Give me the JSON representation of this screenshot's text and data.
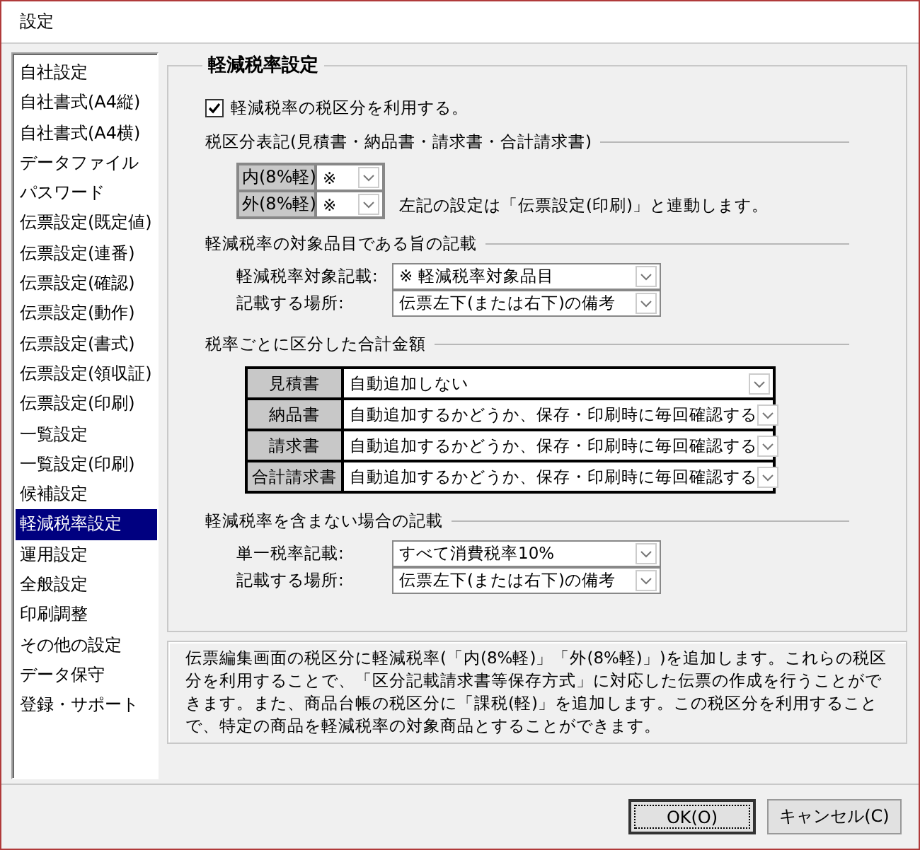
{
  "window": {
    "title": "設定"
  },
  "sidebar": {
    "items": [
      {
        "label": "自社設定",
        "selected": false
      },
      {
        "label": "自社書式(A4縦)",
        "selected": false
      },
      {
        "label": "自社書式(A4横)",
        "selected": false
      },
      {
        "label": "データファイル",
        "selected": false
      },
      {
        "label": "パスワード",
        "selected": false
      },
      {
        "label": "伝票設定(既定値)",
        "selected": false
      },
      {
        "label": "伝票設定(連番)",
        "selected": false
      },
      {
        "label": "伝票設定(確認)",
        "selected": false
      },
      {
        "label": "伝票設定(動作)",
        "selected": false
      },
      {
        "label": "伝票設定(書式)",
        "selected": false
      },
      {
        "label": "伝票設定(領収証)",
        "selected": false
      },
      {
        "label": "伝票設定(印刷)",
        "selected": false
      },
      {
        "label": "一覧設定",
        "selected": false
      },
      {
        "label": "一覧設定(印刷)",
        "selected": false
      },
      {
        "label": "候補設定",
        "selected": false
      },
      {
        "label": "軽減税率設定",
        "selected": true
      },
      {
        "label": "運用設定",
        "selected": false
      },
      {
        "label": "全般設定",
        "selected": false
      },
      {
        "label": "印刷調整",
        "selected": false
      },
      {
        "label": "その他の設定",
        "selected": false
      },
      {
        "label": "データ保守",
        "selected": false
      },
      {
        "label": "登録・サポート",
        "selected": false
      }
    ]
  },
  "panel": {
    "title": "軽減税率設定",
    "use_reduced_rate": {
      "label": "軽減税率の税区分を利用する。",
      "checked": true
    },
    "tax_notation": {
      "heading": "税区分表記(見積書・納品書・請求書・合計請求書)",
      "rows": [
        {
          "label": "内(8%軽)",
          "value": "※"
        },
        {
          "label": "外(8%軽)",
          "value": "※"
        }
      ],
      "note": "左記の設定は「伝票設定(印刷)」と連動します。"
    },
    "target_notice": {
      "heading": "軽減税率の対象品目である旨の記載",
      "rows": [
        {
          "label": "軽減税率対象記載:",
          "value": "※ 軽減税率対象品目"
        },
        {
          "label": "記載する場所:",
          "value": "伝票左下(または右下)の備考"
        }
      ]
    },
    "totals": {
      "heading": "税率ごとに区分した合計金額",
      "rows": [
        {
          "label": "見積書",
          "value": "自動追加しない"
        },
        {
          "label": "納品書",
          "value": "自動追加するかどうか、保存・印刷時に毎回確認する"
        },
        {
          "label": "請求書",
          "value": "自動追加するかどうか、保存・印刷時に毎回確認する"
        },
        {
          "label": "合計請求書",
          "value": "自動追加するかどうか、保存・印刷時に毎回確認する"
        }
      ]
    },
    "no_reduced": {
      "heading": "軽減税率を含まない場合の記載",
      "rows": [
        {
          "label": "単一税率記載:",
          "value": "すべて消費税率10%"
        },
        {
          "label": "記載する場所:",
          "value": "伝票左下(または右下)の備考"
        }
      ]
    }
  },
  "description": "伝票編集画面の税区分に軽減税率(「内(8%軽)」「外(8%軽)」)を追加します。これらの税区分を利用することで、「区分記載請求書等保存方式」に対応した伝票の作成を行うことができます。また、商品台帳の税区分に「課税(軽)」を追加します。この税区分を利用することで、特定の商品を軽減税率の対象商品とすることができます。",
  "buttons": [
    {
      "label": "OK(O)",
      "default": true
    },
    {
      "label": "キャンセル(C)",
      "default": false
    }
  ]
}
